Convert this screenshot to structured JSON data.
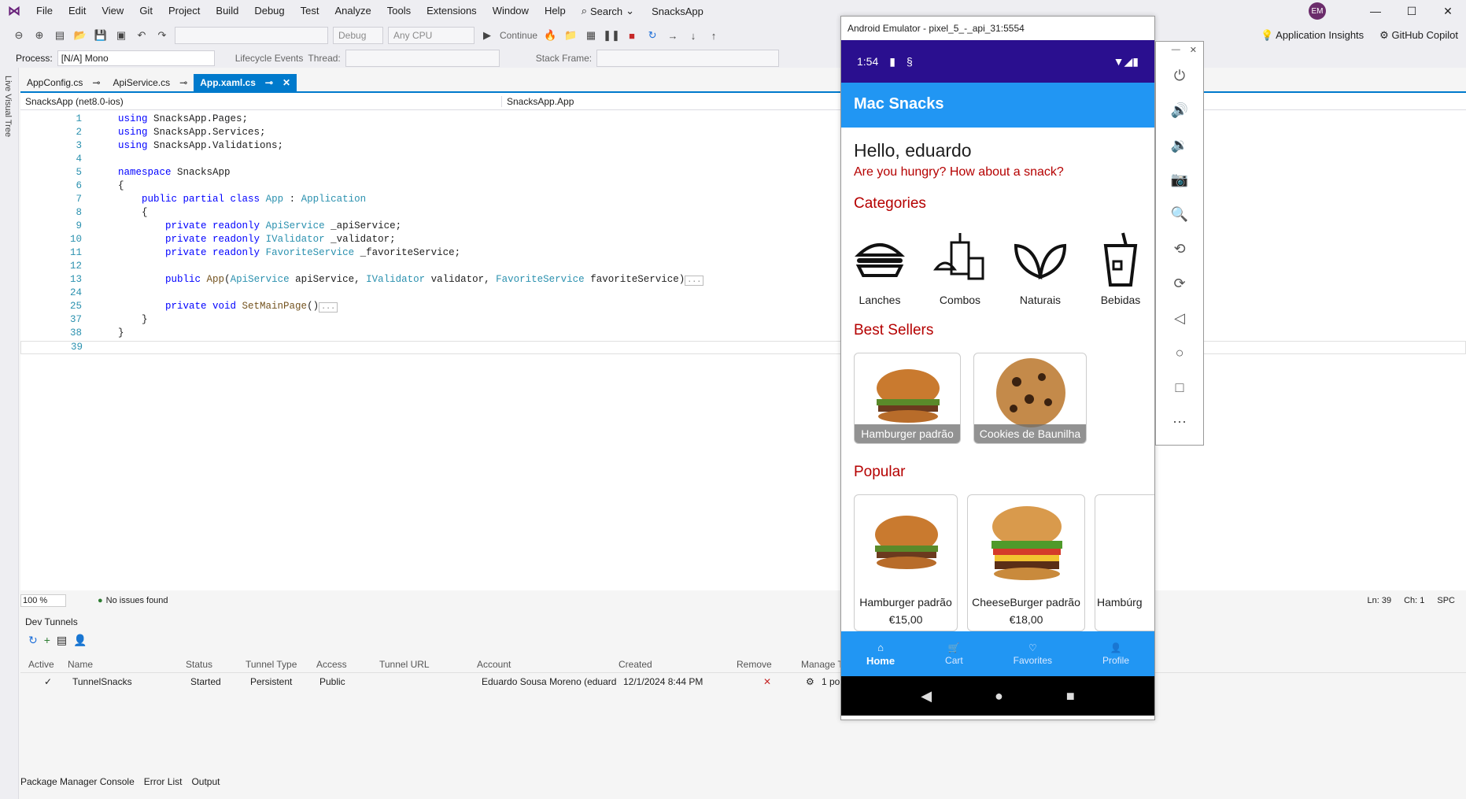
{
  "menubar": {
    "items": [
      "File",
      "Edit",
      "View",
      "Git",
      "Project",
      "Build",
      "Debug",
      "Test",
      "Analyze",
      "Tools",
      "Extensions",
      "Window",
      "Help"
    ],
    "search": "Search",
    "app_name": "SnacksApp",
    "avatar": "EM"
  },
  "toolbar": {
    "config": "Debug",
    "platform": "Any CPU",
    "continue": "Continue",
    "app_insights": "Application Insights",
    "copilot": "GitHub Copilot"
  },
  "procbar": {
    "process_label": "Process:",
    "process_value": "[N/A] Mono",
    "lifecycle": "Lifecycle Events",
    "thread": "Thread:",
    "stack_frame": "Stack Frame:"
  },
  "left_strip": "Live Visual Tree",
  "tabs": [
    "AppConfig.cs",
    "ApiService.cs",
    "App.xaml.cs"
  ],
  "navbar": {
    "project": "SnacksApp (net8.0-ios)",
    "class": "SnacksApp.App"
  },
  "code": [
    {
      "n": "1",
      "t": "using SnacksApp.Pages;"
    },
    {
      "n": "2",
      "t": "using SnacksApp.Services;"
    },
    {
      "n": "3",
      "t": "using SnacksApp.Validations;"
    },
    {
      "n": "4",
      "t": ""
    },
    {
      "n": "5",
      "t": "namespace SnacksApp"
    },
    {
      "n": "6",
      "t": "{"
    },
    {
      "n": "7",
      "t": "    public partial class App : Application"
    },
    {
      "n": "8",
      "t": "    {"
    },
    {
      "n": "9",
      "t": "        private readonly ApiService _apiService;"
    },
    {
      "n": "10",
      "t": "        private readonly IValidator _validator;"
    },
    {
      "n": "11",
      "t": "        private readonly FavoriteService _favoriteService;"
    },
    {
      "n": "12",
      "t": ""
    },
    {
      "n": "13",
      "t": "        public App(ApiService apiService, IValidator validator, FavoriteService favoriteService)"
    },
    {
      "n": "24",
      "t": ""
    },
    {
      "n": "25",
      "t": "        private void SetMainPage()"
    },
    {
      "n": "37",
      "t": "    }"
    },
    {
      "n": "38",
      "t": "}"
    },
    {
      "n": "39",
      "t": ""
    }
  ],
  "editor_status": {
    "zoom": "100 %",
    "issues": "No issues found",
    "ln": "Ln: 39",
    "ch": "Ch: 1",
    "enc": "SPC"
  },
  "devtunnels": {
    "title": "Dev Tunnels",
    "headers": [
      "Active",
      "Name",
      "Status",
      "Tunnel Type",
      "Access",
      "Tunnel URL",
      "Account",
      "Created",
      "Remove",
      "Manage T"
    ],
    "row": {
      "name": "TunnelSnacks",
      "status": "Started",
      "type": "Persistent",
      "access": "Public",
      "account": "Eduardo Sousa Moreno (eduard",
      "created": "12/1/2024 8:44 PM",
      "manage": "1 po"
    }
  },
  "bottom_tabs": [
    "Package Manager Console",
    "Error List",
    "Output"
  ],
  "emulator": {
    "title": "Android Emulator - pixel_5_-_api_31:5554",
    "time": "1:54",
    "app_title": "Mac Snacks",
    "greeting": "Hello, eduardo",
    "tagline": "Are you hungry? How about a snack?",
    "categories_title": "Categories",
    "categories": [
      "Lanches",
      "Combos",
      "Naturais",
      "Bebidas"
    ],
    "best_title": "Best Sellers",
    "best": [
      "Hamburger padrão",
      "Cookies de Baunilha"
    ],
    "popular_title": "Popular",
    "popular": [
      "Hamburger padrão",
      "CheeseBurger padrão",
      "Hambúrg"
    ],
    "popular_prices": [
      "€15,00",
      "€18,00"
    ],
    "nav": [
      "Home",
      "Cart",
      "Favorites",
      "Profile"
    ]
  },
  "colors": {
    "accent": "#007acc",
    "app_bar": "#2196f3",
    "status_bar": "#2a0f8f",
    "red_text": "#b50000"
  }
}
